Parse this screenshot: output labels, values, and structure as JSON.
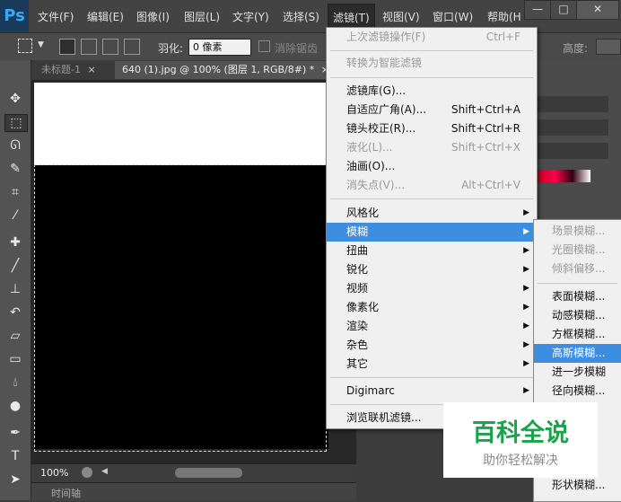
{
  "app": {
    "logo": "Ps"
  },
  "menubar": {
    "items": [
      "文件(F)",
      "编辑(E)",
      "图像(I)",
      "图层(L)",
      "文字(Y)",
      "选择(S)",
      "滤镜(T)",
      "视图(V)",
      "窗口(W)",
      "帮助(H"
    ],
    "active": "滤镜(T)"
  },
  "window_controls": {
    "minimize": "—",
    "maximize": "□",
    "close": "✕"
  },
  "options": {
    "feather_label": "羽化:",
    "feather_value": "0 像素",
    "antialias_label": "消除锯齿",
    "height_label": "高度:"
  },
  "tabs": [
    {
      "label": "未标题-1",
      "close": "×"
    },
    {
      "label": "640 (1).jpg @ 100% (图层 1, RGB/8#) *",
      "close": "×"
    }
  ],
  "status": {
    "zoom": "100%"
  },
  "timeline": {
    "label": "时间轴"
  },
  "filter_menu": {
    "last_filter": "上次滤镜操作(F)",
    "last_filter_sc": "Ctrl+F",
    "convert_smart": "转换为智能滤镜",
    "gallery": "滤镜库(G)...",
    "adaptive_wide": "自适应广角(A)...",
    "adaptive_wide_sc": "Shift+Ctrl+A",
    "lens_correction": "镜头校正(R)...",
    "lens_correction_sc": "Shift+Ctrl+R",
    "liquify": "液化(L)...",
    "liquify_sc": "Shift+Ctrl+X",
    "oil_paint": "油画(O)...",
    "vanishing_point": "消失点(V)...",
    "vanishing_point_sc": "Alt+Ctrl+V",
    "stylize": "风格化",
    "blur": "模糊",
    "distort": "扭曲",
    "sharpen": "锐化",
    "video": "视频",
    "pixelate": "像素化",
    "render": "渲染",
    "noise": "杂色",
    "other": "其它",
    "digimarc": "Digimarc",
    "browse_online": "浏览联机滤镜..."
  },
  "blur_submenu": {
    "field_blur": "场景模糊...",
    "iris_blur": "光圈模糊...",
    "tilt_shift": "倾斜偏移...",
    "surface_blur": "表面模糊...",
    "motion_blur": "动感模糊...",
    "box_blur": "方框模糊...",
    "gaussian_blur": "高斯模糊...",
    "blur_more": "进一步模糊",
    "radial_blur": "径向模糊...",
    "shape_blur": "形状模糊..."
  },
  "watermark": {
    "title": "百科全说",
    "subtitle": "助你轻松解决"
  },
  "colors": {
    "highlight": "#3d8ee0",
    "watermark_green": "#1aa34a"
  }
}
